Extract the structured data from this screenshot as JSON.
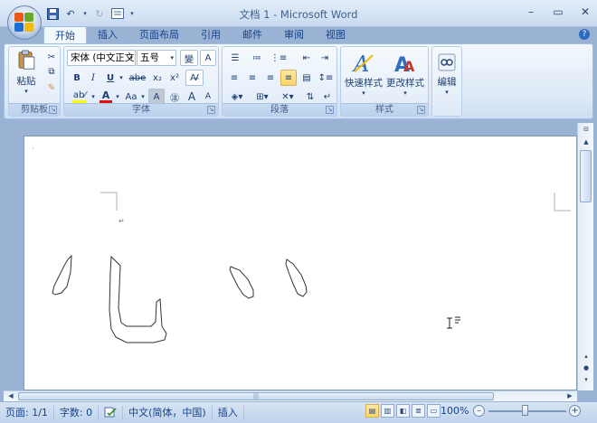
{
  "window": {
    "title": "文档 1 - Microsoft Word"
  },
  "tabs": [
    "开始",
    "插入",
    "页面布局",
    "引用",
    "邮件",
    "审阅",
    "视图"
  ],
  "ribbon": {
    "clipboard": {
      "label": "剪贴板",
      "paste": "粘贴"
    },
    "font": {
      "label": "字体",
      "font_name": "宋体 (中文正文",
      "font_size": "五号",
      "bold": "B",
      "italic": "I",
      "underline": "U",
      "strike": "abe",
      "subscript": "x₂",
      "superscript": "x²",
      "grow": "A",
      "shrink": "A",
      "case": "Aa"
    },
    "paragraph": {
      "label": "段落"
    },
    "styles": {
      "label": "样式",
      "quick_styles": "快速样式",
      "change_styles": "更改样式"
    },
    "editing": {
      "label": "编辑"
    }
  },
  "status": {
    "page": "页面: 1/1",
    "words": "字数: 0",
    "language": "中文(简体，中国)",
    "mode": "插入",
    "zoom": "100%"
  },
  "colors": {
    "highlight": "#ffff00",
    "font_color": "#e01010",
    "accent": "#15428b"
  }
}
